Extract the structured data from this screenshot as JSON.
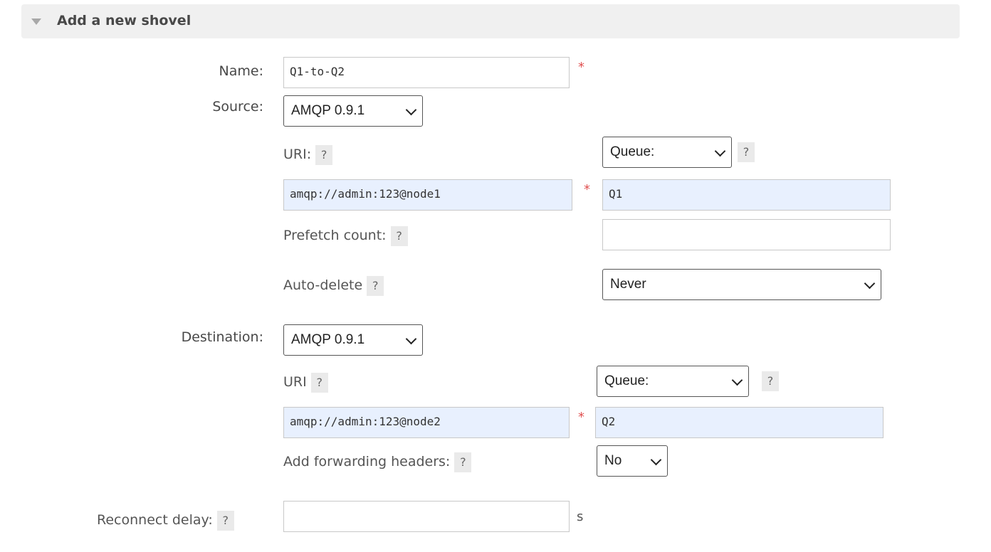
{
  "section": {
    "title": "Add a new shovel"
  },
  "form": {
    "name_label": "Name:",
    "name_value": "Q1-to-Q2",
    "required_mark": "*",
    "source_label": "Source:",
    "source_protocol": "AMQP 0.9.1",
    "destination_label": "Destination:",
    "destination_protocol": "AMQP 0.9.1",
    "reconnect_label": "Reconnect delay:",
    "reconnect_value": "",
    "reconnect_unit": "s",
    "help_mark": "?"
  },
  "source": {
    "uri_label": "URI:",
    "uri_value": "amqp://admin:123@node1",
    "type_select": "Queue:",
    "queue_value": "Q1",
    "prefetch_label": "Prefetch count:",
    "prefetch_value": "",
    "autodelete_label": "Auto-delete",
    "autodelete_value": "Never"
  },
  "destination": {
    "uri_label": "URI",
    "uri_value": "amqp://admin:123@node2",
    "type_select": "Queue:",
    "queue_value": "Q2",
    "fwd_headers_label": "Add forwarding headers:",
    "fwd_headers_value": "No"
  }
}
